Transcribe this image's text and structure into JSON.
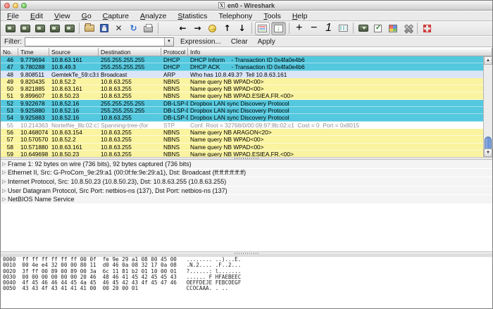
{
  "window": {
    "title": "en0 - Wireshark"
  },
  "menu": {
    "items": [
      {
        "label": "File",
        "mnemonic": 0
      },
      {
        "label": "Edit",
        "mnemonic": 0
      },
      {
        "label": "View",
        "mnemonic": 0
      },
      {
        "label": "Go",
        "mnemonic": 0
      },
      {
        "label": "Capture",
        "mnemonic": 0
      },
      {
        "label": "Analyze",
        "mnemonic": 0
      },
      {
        "label": "Statistics",
        "mnemonic": 0
      },
      {
        "label": "Telephony",
        "mnemonic": -1
      },
      {
        "label": "Tools",
        "mnemonic": 0
      },
      {
        "label": "Help",
        "mnemonic": 0
      }
    ]
  },
  "toolbar": {
    "items": [
      {
        "name": "interfaces-icon",
        "cls": "dev dev-list"
      },
      {
        "name": "capture-options-icon",
        "cls": "dev dev-gear"
      },
      {
        "name": "capture-start-icon",
        "cls": "dev dev-start"
      },
      {
        "name": "capture-stop-icon",
        "cls": "dev dev-stop"
      },
      {
        "name": "capture-restart-icon",
        "cls": "dev dev-restart"
      },
      {
        "sep": true
      },
      {
        "name": "open-file-icon",
        "cls": "folder"
      },
      {
        "name": "save-file-icon",
        "cls": "floppy"
      },
      {
        "name": "close-capture-icon",
        "cls": "close",
        "glyph": "✕"
      },
      {
        "name": "reload-icon",
        "cls": "reload",
        "glyph": "↻"
      },
      {
        "name": "print-icon",
        "cls": "print"
      },
      {
        "sep": true
      },
      {
        "name": "find-packet-icon",
        "cls": "mag"
      },
      {
        "name": "go-back-icon",
        "cls": "arrow",
        "glyph": "←"
      },
      {
        "name": "go-forward-icon",
        "cls": "arrow",
        "glyph": "→"
      },
      {
        "name": "goto-packet-icon",
        "cls": "goto"
      },
      {
        "name": "go-top-icon",
        "cls": "arrow bar-top",
        "glyph": "↑"
      },
      {
        "name": "go-bottom-icon",
        "cls": "arrow bar-bottom",
        "glyph": "↓"
      },
      {
        "sep": true
      },
      {
        "name": "colorize-list-icon",
        "cls": "colorize",
        "framed": true
      },
      {
        "name": "autoscroll-icon",
        "cls": "autoscroll",
        "framed": true,
        "pressed": true
      },
      {
        "sep": true
      },
      {
        "name": "zoom-in-icon",
        "cls": "mag",
        "inner": "+"
      },
      {
        "name": "zoom-out-icon",
        "cls": "mag",
        "inner": "−"
      },
      {
        "name": "zoom-100-icon",
        "cls": "mag",
        "inner": "1"
      },
      {
        "name": "resize-columns-icon",
        "cls": "fit"
      },
      {
        "sep": true
      },
      {
        "name": "capture-filters-icon",
        "cls": "cfilter"
      },
      {
        "name": "display-filters-icon",
        "cls": "dfilter"
      },
      {
        "name": "coloring-rules-icon",
        "cls": "colrules"
      },
      {
        "name": "preferences-icon",
        "cls": "prefs"
      },
      {
        "sep": true
      },
      {
        "name": "help-icon",
        "cls": "netmap"
      }
    ]
  },
  "filter": {
    "label": "Filter:",
    "value": "",
    "buttons": [
      "Expression...",
      "Clear",
      "Apply"
    ]
  },
  "packet_list": {
    "columns": [
      "No.",
      "Time",
      "Source",
      "Destination",
      "Protocol",
      "Info"
    ],
    "rows": [
      {
        "no": "46",
        "time": "9.779694",
        "src": "10.8.63.161",
        "dst": "255.255.255.255",
        "proto": "DHCP",
        "info": "DHCP Inform    - Transaction ID 0x4fa0e4b6",
        "color": "udp"
      },
      {
        "no": "47",
        "time": "9.780288",
        "src": "10.8.49.3",
        "dst": "255.255.255.255",
        "proto": "DHCP",
        "info": "DHCP ACK       - Transaction ID 0x4fa0e4b6",
        "color": "udp"
      },
      {
        "no": "48",
        "time": "9.808511",
        "src": "GemtekTe_59:c3:ba",
        "dst": "Broadcast",
        "proto": "ARP",
        "info": "Who has 10.8.49.3?  Tell 10.8.63.161",
        "color": "arp"
      },
      {
        "no": "49",
        "time": "9.820435",
        "src": "10.8.52.2",
        "dst": "10.8.63.255",
        "proto": "NBNS",
        "info": "Name query NB WPAD<00>",
        "color": "nbns"
      },
      {
        "no": "50",
        "time": "9.821885",
        "src": "10.8.63.161",
        "dst": "10.8.63.255",
        "proto": "NBNS",
        "info": "Name query NB WPAD<00>",
        "color": "nbns"
      },
      {
        "no": "51",
        "time": "9.899607",
        "src": "10.8.50.23",
        "dst": "10.8.63.255",
        "proto": "NBNS",
        "info": "Name query NB WPAD.ESIEA.FR.<00>",
        "color": "nbns"
      },
      {
        "no": "52",
        "time": "9.922678",
        "src": "10.8.52.16",
        "dst": "255.255.255.255",
        "proto": "DB-LSP-DI",
        "info": "Dropbox LAN sync Discovery Protocol",
        "color": "udp"
      },
      {
        "no": "53",
        "time": "9.925880",
        "src": "10.8.52.16",
        "dst": "255.255.255.255",
        "proto": "DB-LSP-DI",
        "info": "Dropbox LAN sync Discovery Protocol",
        "color": "udp"
      },
      {
        "no": "54",
        "time": "9.925883",
        "src": "10.8.52.16",
        "dst": "10.8.63.255",
        "proto": "DB-LSP-DI",
        "info": "Dropbox LAN sync Discovery Protocol",
        "color": "udp"
      },
      {
        "no": "55",
        "time": "10.214363",
        "src": "NortelNe_8b:02:c1",
        "dst": "Spanning-tree-(for",
        "proto": "STP",
        "info": "Conf. Root = 32768/0/00:09:97:8b:02:c1  Cost = 0  Port = 0x8015",
        "color": "stp"
      },
      {
        "no": "56",
        "time": "10.468074",
        "src": "10.8.63.154",
        "dst": "10.8.63.255",
        "proto": "NBNS",
        "info": "Name query NB ARAGON<20>",
        "color": "nbns"
      },
      {
        "no": "57",
        "time": "10.570570",
        "src": "10.8.52.2",
        "dst": "10.8.63.255",
        "proto": "NBNS",
        "info": "Name query NB WPAD<00>",
        "color": "nbns"
      },
      {
        "no": "58",
        "time": "10.571880",
        "src": "10.8.63.161",
        "dst": "10.8.63.255",
        "proto": "NBNS",
        "info": "Name query NB WPAD<00>",
        "color": "nbns"
      },
      {
        "no": "59",
        "time": "10.649698",
        "src": "10.8.50.23",
        "dst": "10.8.63.255",
        "proto": "NBNS",
        "info": "Name query NB WPAD.ESIEA.FR.<00>",
        "color": "nbns"
      }
    ]
  },
  "details": {
    "rows": [
      "Frame 1: 92 bytes on wire (736 bits), 92 bytes captured (736 bits)",
      "Ethernet II, Src: G-ProCom_9e:29:a1 (00:0f:fe:9e:29:a1), Dst: Broadcast (ff:ff:ff:ff:ff:ff)",
      "Internet Protocol, Src: 10.8.50.23 (10.8.50.23), Dst: 10.8.63.255 (10.8.63.255)",
      "User Datagram Protocol, Src Port: netbios-ns (137), Dst Port: netbios-ns (137)",
      "NetBIOS Name Service"
    ],
    "expander_glyph": "▷"
  },
  "hex": {
    "rows": [
      {
        "off": "0000",
        "h1": "ff ff ff ff ff ff 00 0f",
        "h2": "fe 9e 29 a1 08 00 45 00",
        "ascii": "........ ..)...E."
      },
      {
        "off": "0010",
        "h1": "00 4e e4 32 00 00 80 11",
        "h2": "d0 46 0a 08 32 17 0a 08",
        "ascii": ".N.2.... .F..2..."
      },
      {
        "off": "0020",
        "h1": "3f ff 00 89 00 89 00 3a",
        "h2": "6c 11 81 b2 01 10 00 01",
        "ascii": "?......: l......."
      },
      {
        "off": "0030",
        "h1": "00 00 00 00 00 00 20 46",
        "h2": "48 46 41 45 42 45 45 43",
        "ascii": "...... F HFAEBEEC"
      },
      {
        "off": "0040",
        "h1": "4f 45 46 46 44 45 4a 45",
        "h2": "46 45 42 43 4f 45 47 46",
        "ascii": "OEFFDEJE FEBCOEGF"
      },
      {
        "off": "0050",
        "h1": "43 43 4f 43 41 41 41 00",
        "h2": "00 20 00 01",
        "ascii": "CCOCAAA. . .."
      }
    ]
  },
  "colors": {
    "row_udp": "#54c8de",
    "row_nbns": "#faf3a0",
    "row_arp": "#dbe5f7",
    "row_stp_text": "#8f8f8f",
    "scroll_thumb": "#6a92d4"
  }
}
